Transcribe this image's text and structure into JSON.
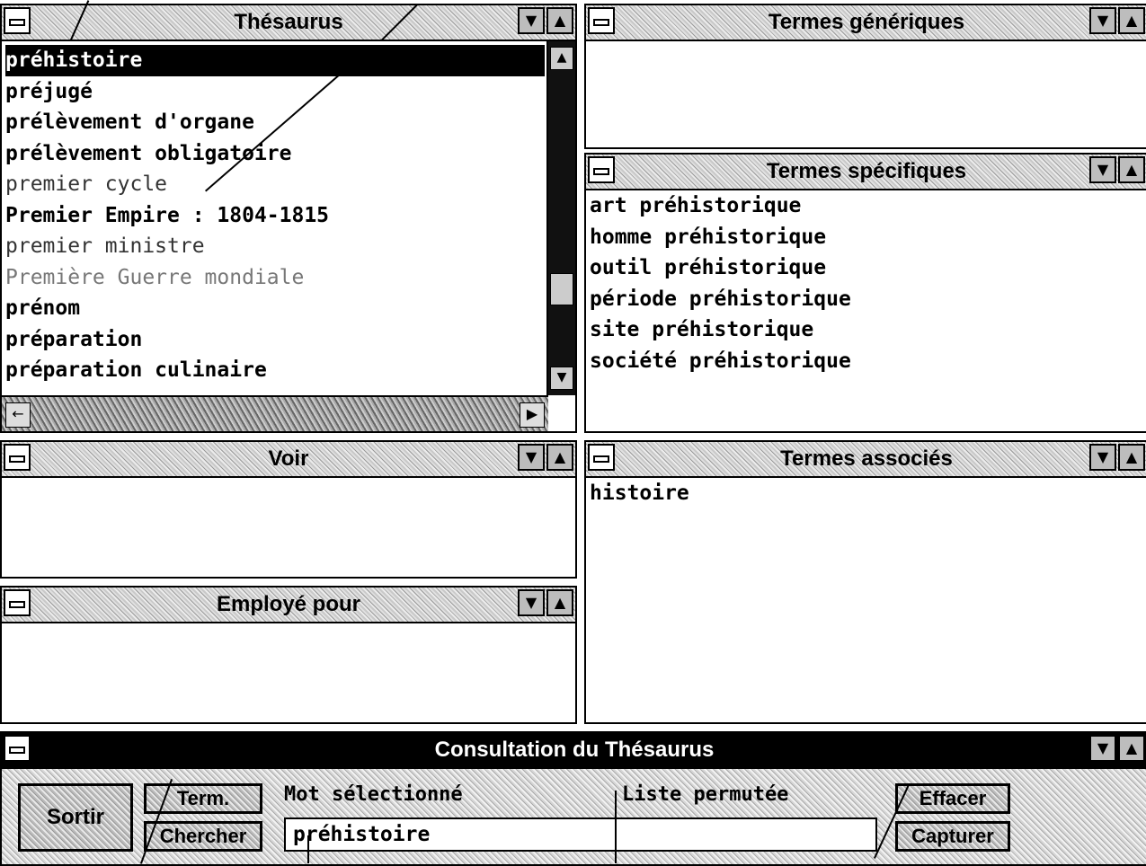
{
  "thesaurus": {
    "title": "Thésaurus",
    "items": [
      "préhistoire",
      "préjugé",
      "prélèvement d'organe",
      "prélèvement obligatoire",
      "premier cycle",
      "Premier Empire : 1804-1815",
      "premier ministre",
      "Première Guerre mondiale",
      "prénom",
      "préparation",
      "préparation culinaire"
    ]
  },
  "generic": {
    "title": "Termes génériques",
    "items": []
  },
  "specific": {
    "title": "Termes spécifiques",
    "items": [
      "art préhistorique",
      "homme préhistorique",
      "outil préhistorique",
      "période préhistorique",
      "site préhistorique",
      "société préhistorique"
    ]
  },
  "voir": {
    "title": "Voir",
    "items": []
  },
  "associated": {
    "title": "Termes associés",
    "items": [
      "histoire"
    ]
  },
  "employe": {
    "title": "Employé pour",
    "items": []
  },
  "consultation": {
    "title": "Consultation du Thésaurus",
    "sortir": "Sortir",
    "term": "Term.",
    "chercher": "Chercher",
    "mot_label": "Mot sélectionné",
    "mot_value": "préhistoire",
    "liste_label": "Liste permutée",
    "effacer": "Effacer",
    "capturer": "Capturer"
  },
  "icons": {
    "system_menu": "system-menu-icon",
    "minimize": "minimize-icon",
    "maximize": "maximize-icon",
    "scroll_up": "scroll-up-icon",
    "scroll_down": "scroll-down-icon",
    "scroll_left": "scroll-left-icon",
    "scroll_right": "scroll-right-icon"
  }
}
